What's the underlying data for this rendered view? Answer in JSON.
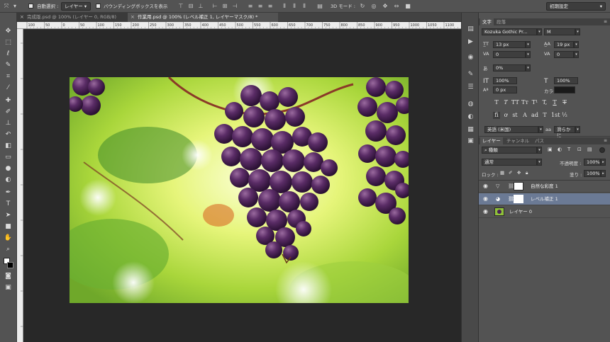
{
  "options_bar": {
    "auto_select_label": "自動選択 :",
    "auto_select_value": "レイヤー",
    "bounding_box_label": "バウンディングボックスを表示",
    "mode_3d_label": "3D モード :",
    "workspace_value": "初期設定"
  },
  "tabs": [
    {
      "label": "完成版.psd @ 100% (レイヤー 0, RGB/8)"
    },
    {
      "label": "作業用.psd @ 100% (レベル補正 1, レイヤーマスク/8) *"
    }
  ],
  "ruler": {
    "labels": [
      "100",
      "50",
      "0",
      "50",
      "100",
      "150",
      "200",
      "250",
      "300",
      "350",
      "400",
      "450",
      "500",
      "550",
      "600",
      "650",
      "700",
      "750",
      "800",
      "850",
      "900",
      "950",
      "1000",
      "1050",
      "1100",
      "1150"
    ]
  },
  "character_panel": {
    "tab_character": "文字",
    "tab_paragraph": "段落",
    "font_family": "Kozuka Gothic Pr...",
    "font_style": "M",
    "font_size": "13 px",
    "leading": "19 px",
    "kerning": "0",
    "tracking": "0",
    "tsume": "0%",
    "vertical_scale": "100%",
    "horizontal_scale": "100%",
    "baseline_shift": "0 px",
    "color_label": "カラー :",
    "format_buttons": [
      "T",
      "T",
      "TT",
      "Tт",
      "T¹",
      "T,",
      "T",
      "T"
    ],
    "opentype_buttons": [
      "fi",
      "ơ",
      "st",
      "A",
      "ad",
      "T",
      "1st",
      "½"
    ],
    "language": "英語 (米国)",
    "antialias_label": "aa",
    "antialias": "滑らかに"
  },
  "layers_panel": {
    "tab_layers": "レイヤー",
    "tab_channels": "チャンネル",
    "tab_paths": "パス",
    "filter_kind": "種類",
    "blend_mode": "通常",
    "opacity_label": "不透明度 :",
    "opacity": "100%",
    "lock_label": "ロック :",
    "fill_label": "塗り :",
    "fill": "100%",
    "layers": [
      {
        "name": "自然な彩度 1",
        "selected": false
      },
      {
        "name": "レベル補正 1",
        "selected": true
      },
      {
        "name": "レイヤー 0",
        "selected": false
      }
    ]
  },
  "colors": {
    "accent_selected_layer": "#6b7a95",
    "panel_bg": "#535353",
    "canvas_bg": "#282828"
  }
}
